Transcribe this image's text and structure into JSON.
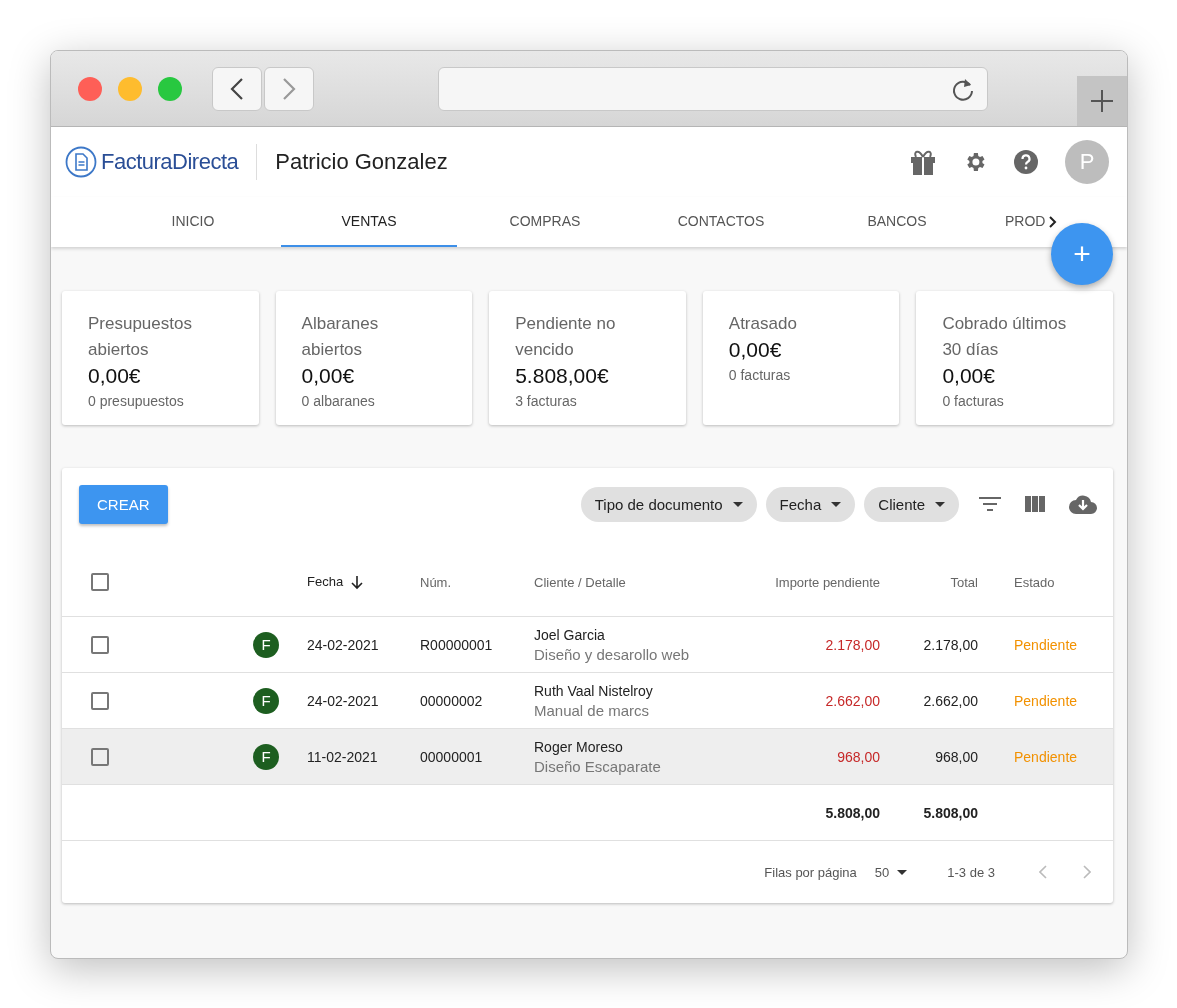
{
  "app": {
    "logo": "FacturaDirecta",
    "company": "Patricio Gonzalez",
    "avatar": "P"
  },
  "tabs": [
    {
      "label": "INICIO",
      "selected": false
    },
    {
      "label": "VENTAS",
      "selected": true
    },
    {
      "label": "COMPRAS",
      "selected": false
    },
    {
      "label": "CONTACTOS",
      "selected": false
    },
    {
      "label": "BANCOS",
      "selected": false
    },
    {
      "label": "PROD",
      "selected": false
    }
  ],
  "fab": "+",
  "cards": [
    {
      "title": "Presupuestos abiertos",
      "amount": "0,00€",
      "count": "0 presupuestos"
    },
    {
      "title": "Albaranes abiertos",
      "amount": "0,00€",
      "count": "0 albaranes"
    },
    {
      "title": "Pendiente no vencido",
      "amount": "5.808,00€",
      "count": "3 facturas"
    },
    {
      "title": "Atrasado",
      "amount": "0,00€",
      "count": "0 facturas"
    },
    {
      "title": "Cobrado últimos 30 días",
      "amount": "0,00€",
      "count": "0 facturas"
    }
  ],
  "toolbar": {
    "create": "CREAR",
    "filters": [
      "Tipo de documento",
      "Fecha",
      "Cliente"
    ]
  },
  "table": {
    "select_all_checked": false,
    "columns": [
      "Fecha",
      "Núm.",
      "Cliente / Detalle",
      "Importe pendiente",
      "Total",
      "Estado"
    ],
    "rows": [
      {
        "checked": false,
        "highlighted": false,
        "badge": "F",
        "date": "24-02-2021",
        "number": "R00000001",
        "client": "Joel Garcia",
        "detail": "Diseño y desarollo web",
        "pending": "2.178,00",
        "total": "2.178,00",
        "status": "Pendiente"
      },
      {
        "checked": false,
        "highlighted": false,
        "badge": "F",
        "date": "24-02-2021",
        "number": "00000002",
        "client": "Ruth Vaal Nistelroy",
        "detail": "Manual de marcs",
        "pending": "2.662,00",
        "total": "2.662,00",
        "status": "Pendiente"
      },
      {
        "checked": false,
        "highlighted": true,
        "badge": "F",
        "date": "11-02-2021",
        "number": "00000001",
        "client": "Roger Moreso",
        "detail": "Diseño Escaparate",
        "pending": "968,00",
        "total": "968,00",
        "status": "Pendiente"
      }
    ],
    "totals": {
      "pending": "5.808,00",
      "total": "5.808,00"
    }
  },
  "pagination": {
    "rows_label": "Filas por página",
    "rows_value": "50",
    "range": "1-3 de 3"
  }
}
